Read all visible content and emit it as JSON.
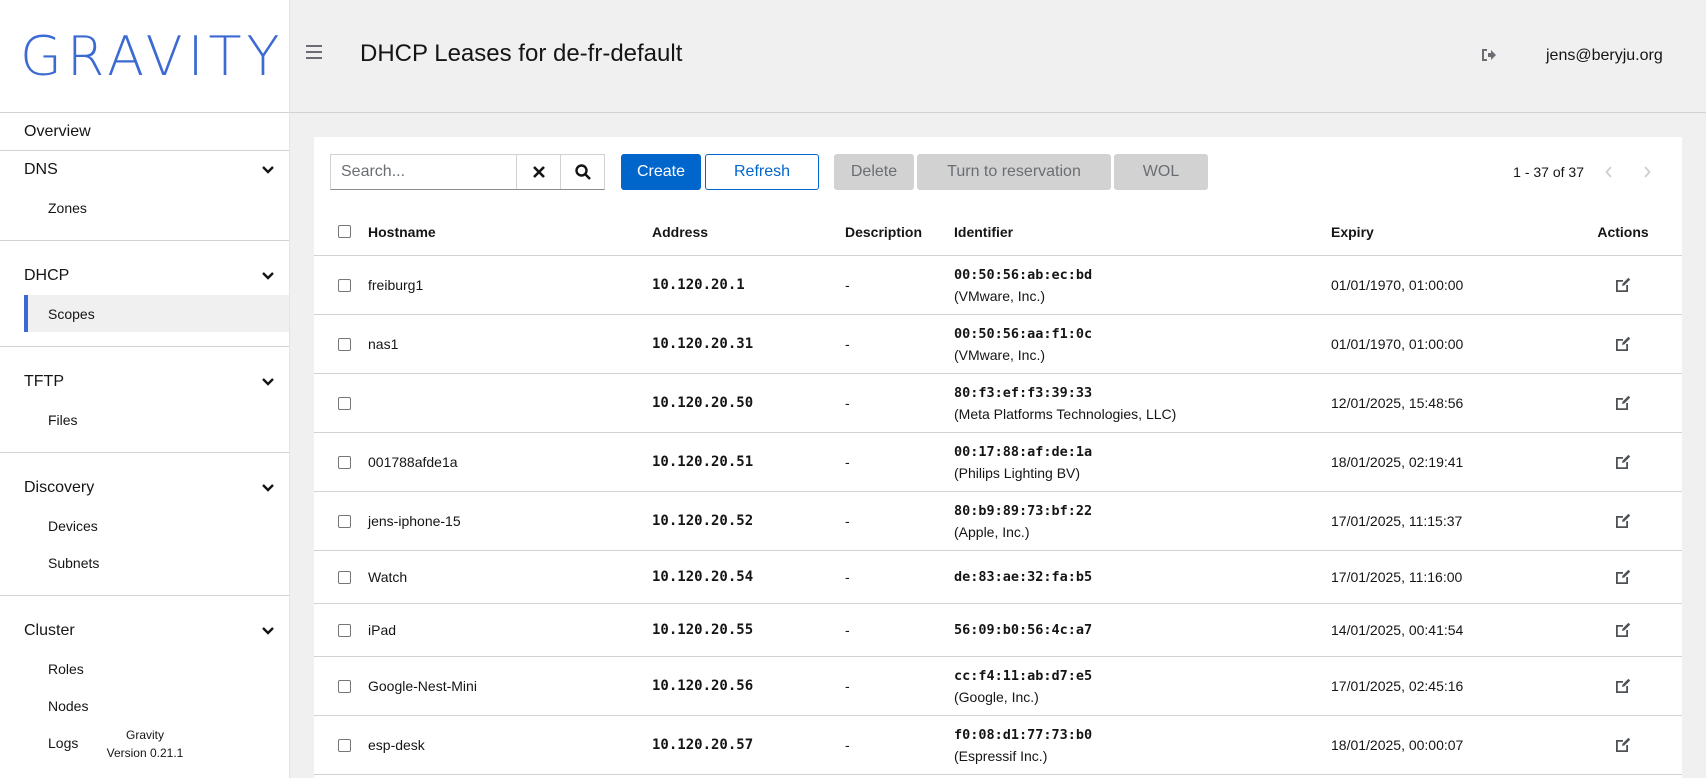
{
  "app": {
    "logo": "GRAVITY",
    "name": "Gravity",
    "version": "Version 0.21.1"
  },
  "header": {
    "title": "DHCP Leases for de-fr-default",
    "user": "jens@beryju.org"
  },
  "sidebar": {
    "overview": "Overview",
    "groups": [
      {
        "label": "DNS",
        "items": [
          "Zones"
        ]
      },
      {
        "label": "DHCP",
        "items": [
          "Scopes"
        ],
        "active": "Scopes"
      },
      {
        "label": "TFTP",
        "items": [
          "Files"
        ]
      },
      {
        "label": "Discovery",
        "items": [
          "Devices",
          "Subnets"
        ]
      },
      {
        "label": "Cluster",
        "items": [
          "Roles",
          "Nodes",
          "Logs"
        ]
      }
    ]
  },
  "toolbar": {
    "search_placeholder": "Search...",
    "create": "Create",
    "refresh": "Refresh",
    "delete": "Delete",
    "reserve": "Turn to reservation",
    "wol": "WOL",
    "pagination": "1 - 37 of 37"
  },
  "table": {
    "columns": [
      "Hostname",
      "Address",
      "Description",
      "Identifier",
      "Expiry",
      "Actions"
    ],
    "rows": [
      {
        "hostname": "freiburg1",
        "address": "10.120.20.1",
        "description": "-",
        "mac": "00:50:56:ab:ec:bd",
        "vendor": "(VMware, Inc.)",
        "expiry": "01/01/1970, 01:00:00"
      },
      {
        "hostname": "nas1",
        "address": "10.120.20.31",
        "description": "-",
        "mac": "00:50:56:aa:f1:0c",
        "vendor": "(VMware, Inc.)",
        "expiry": "01/01/1970, 01:00:00"
      },
      {
        "hostname": "",
        "address": "10.120.20.50",
        "description": "-",
        "mac": "80:f3:ef:f3:39:33",
        "vendor": "(Meta Platforms Technologies, LLC)",
        "expiry": "12/01/2025, 15:48:56"
      },
      {
        "hostname": "001788afde1a",
        "address": "10.120.20.51",
        "description": "-",
        "mac": "00:17:88:af:de:1a",
        "vendor": "(Philips Lighting BV)",
        "expiry": "18/01/2025, 02:19:41"
      },
      {
        "hostname": "jens-iphone-15",
        "address": "10.120.20.52",
        "description": "-",
        "mac": "80:b9:89:73:bf:22",
        "vendor": "(Apple, Inc.)",
        "expiry": "17/01/2025, 11:15:37"
      },
      {
        "hostname": "Watch",
        "address": "10.120.20.54",
        "description": "-",
        "mac": "de:83:ae:32:fa:b5",
        "vendor": "",
        "expiry": "17/01/2025, 11:16:00"
      },
      {
        "hostname": "iPad",
        "address": "10.120.20.55",
        "description": "-",
        "mac": "56:09:b0:56:4c:a7",
        "vendor": "",
        "expiry": "14/01/2025, 00:41:54"
      },
      {
        "hostname": "Google-Nest-Mini",
        "address": "10.120.20.56",
        "description": "-",
        "mac": "cc:f4:11:ab:d7:e5",
        "vendor": "(Google, Inc.)",
        "expiry": "17/01/2025, 02:45:16"
      },
      {
        "hostname": "esp-desk",
        "address": "10.120.20.57",
        "description": "-",
        "mac": "f0:08:d1:77:73:b0",
        "vendor": "(Espressif Inc.)",
        "expiry": "18/01/2025, 00:00:07"
      }
    ]
  },
  "colors": {
    "accent": "#0066cc",
    "logo": "#3c6ad3",
    "active_bar": "#3c6ad3"
  }
}
